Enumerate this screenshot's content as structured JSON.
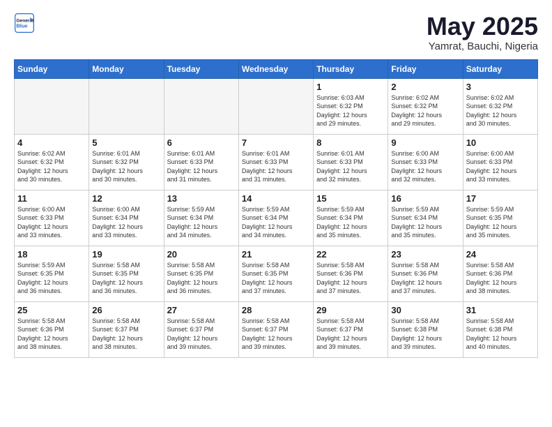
{
  "header": {
    "logo_general": "General",
    "logo_blue": "Blue",
    "title": "May 2025",
    "subtitle": "Yamrat, Bauchi, Nigeria"
  },
  "weekdays": [
    "Sunday",
    "Monday",
    "Tuesday",
    "Wednesday",
    "Thursday",
    "Friday",
    "Saturday"
  ],
  "weeks": [
    [
      {
        "day": "",
        "info": ""
      },
      {
        "day": "",
        "info": ""
      },
      {
        "day": "",
        "info": ""
      },
      {
        "day": "",
        "info": ""
      },
      {
        "day": "1",
        "info": "Sunrise: 6:03 AM\nSunset: 6:32 PM\nDaylight: 12 hours\nand 29 minutes."
      },
      {
        "day": "2",
        "info": "Sunrise: 6:02 AM\nSunset: 6:32 PM\nDaylight: 12 hours\nand 29 minutes."
      },
      {
        "day": "3",
        "info": "Sunrise: 6:02 AM\nSunset: 6:32 PM\nDaylight: 12 hours\nand 30 minutes."
      }
    ],
    [
      {
        "day": "4",
        "info": "Sunrise: 6:02 AM\nSunset: 6:32 PM\nDaylight: 12 hours\nand 30 minutes."
      },
      {
        "day": "5",
        "info": "Sunrise: 6:01 AM\nSunset: 6:32 PM\nDaylight: 12 hours\nand 30 minutes."
      },
      {
        "day": "6",
        "info": "Sunrise: 6:01 AM\nSunset: 6:33 PM\nDaylight: 12 hours\nand 31 minutes."
      },
      {
        "day": "7",
        "info": "Sunrise: 6:01 AM\nSunset: 6:33 PM\nDaylight: 12 hours\nand 31 minutes."
      },
      {
        "day": "8",
        "info": "Sunrise: 6:01 AM\nSunset: 6:33 PM\nDaylight: 12 hours\nand 32 minutes."
      },
      {
        "day": "9",
        "info": "Sunrise: 6:00 AM\nSunset: 6:33 PM\nDaylight: 12 hours\nand 32 minutes."
      },
      {
        "day": "10",
        "info": "Sunrise: 6:00 AM\nSunset: 6:33 PM\nDaylight: 12 hours\nand 33 minutes."
      }
    ],
    [
      {
        "day": "11",
        "info": "Sunrise: 6:00 AM\nSunset: 6:33 PM\nDaylight: 12 hours\nand 33 minutes."
      },
      {
        "day": "12",
        "info": "Sunrise: 6:00 AM\nSunset: 6:34 PM\nDaylight: 12 hours\nand 33 minutes."
      },
      {
        "day": "13",
        "info": "Sunrise: 5:59 AM\nSunset: 6:34 PM\nDaylight: 12 hours\nand 34 minutes."
      },
      {
        "day": "14",
        "info": "Sunrise: 5:59 AM\nSunset: 6:34 PM\nDaylight: 12 hours\nand 34 minutes."
      },
      {
        "day": "15",
        "info": "Sunrise: 5:59 AM\nSunset: 6:34 PM\nDaylight: 12 hours\nand 35 minutes."
      },
      {
        "day": "16",
        "info": "Sunrise: 5:59 AM\nSunset: 6:34 PM\nDaylight: 12 hours\nand 35 minutes."
      },
      {
        "day": "17",
        "info": "Sunrise: 5:59 AM\nSunset: 6:35 PM\nDaylight: 12 hours\nand 35 minutes."
      }
    ],
    [
      {
        "day": "18",
        "info": "Sunrise: 5:59 AM\nSunset: 6:35 PM\nDaylight: 12 hours\nand 36 minutes."
      },
      {
        "day": "19",
        "info": "Sunrise: 5:58 AM\nSunset: 6:35 PM\nDaylight: 12 hours\nand 36 minutes."
      },
      {
        "day": "20",
        "info": "Sunrise: 5:58 AM\nSunset: 6:35 PM\nDaylight: 12 hours\nand 36 minutes."
      },
      {
        "day": "21",
        "info": "Sunrise: 5:58 AM\nSunset: 6:35 PM\nDaylight: 12 hours\nand 37 minutes."
      },
      {
        "day": "22",
        "info": "Sunrise: 5:58 AM\nSunset: 6:36 PM\nDaylight: 12 hours\nand 37 minutes."
      },
      {
        "day": "23",
        "info": "Sunrise: 5:58 AM\nSunset: 6:36 PM\nDaylight: 12 hours\nand 37 minutes."
      },
      {
        "day": "24",
        "info": "Sunrise: 5:58 AM\nSunset: 6:36 PM\nDaylight: 12 hours\nand 38 minutes."
      }
    ],
    [
      {
        "day": "25",
        "info": "Sunrise: 5:58 AM\nSunset: 6:36 PM\nDaylight: 12 hours\nand 38 minutes."
      },
      {
        "day": "26",
        "info": "Sunrise: 5:58 AM\nSunset: 6:37 PM\nDaylight: 12 hours\nand 38 minutes."
      },
      {
        "day": "27",
        "info": "Sunrise: 5:58 AM\nSunset: 6:37 PM\nDaylight: 12 hours\nand 39 minutes."
      },
      {
        "day": "28",
        "info": "Sunrise: 5:58 AM\nSunset: 6:37 PM\nDaylight: 12 hours\nand 39 minutes."
      },
      {
        "day": "29",
        "info": "Sunrise: 5:58 AM\nSunset: 6:37 PM\nDaylight: 12 hours\nand 39 minutes."
      },
      {
        "day": "30",
        "info": "Sunrise: 5:58 AM\nSunset: 6:38 PM\nDaylight: 12 hours\nand 39 minutes."
      },
      {
        "day": "31",
        "info": "Sunrise: 5:58 AM\nSunset: 6:38 PM\nDaylight: 12 hours\nand 40 minutes."
      }
    ]
  ]
}
